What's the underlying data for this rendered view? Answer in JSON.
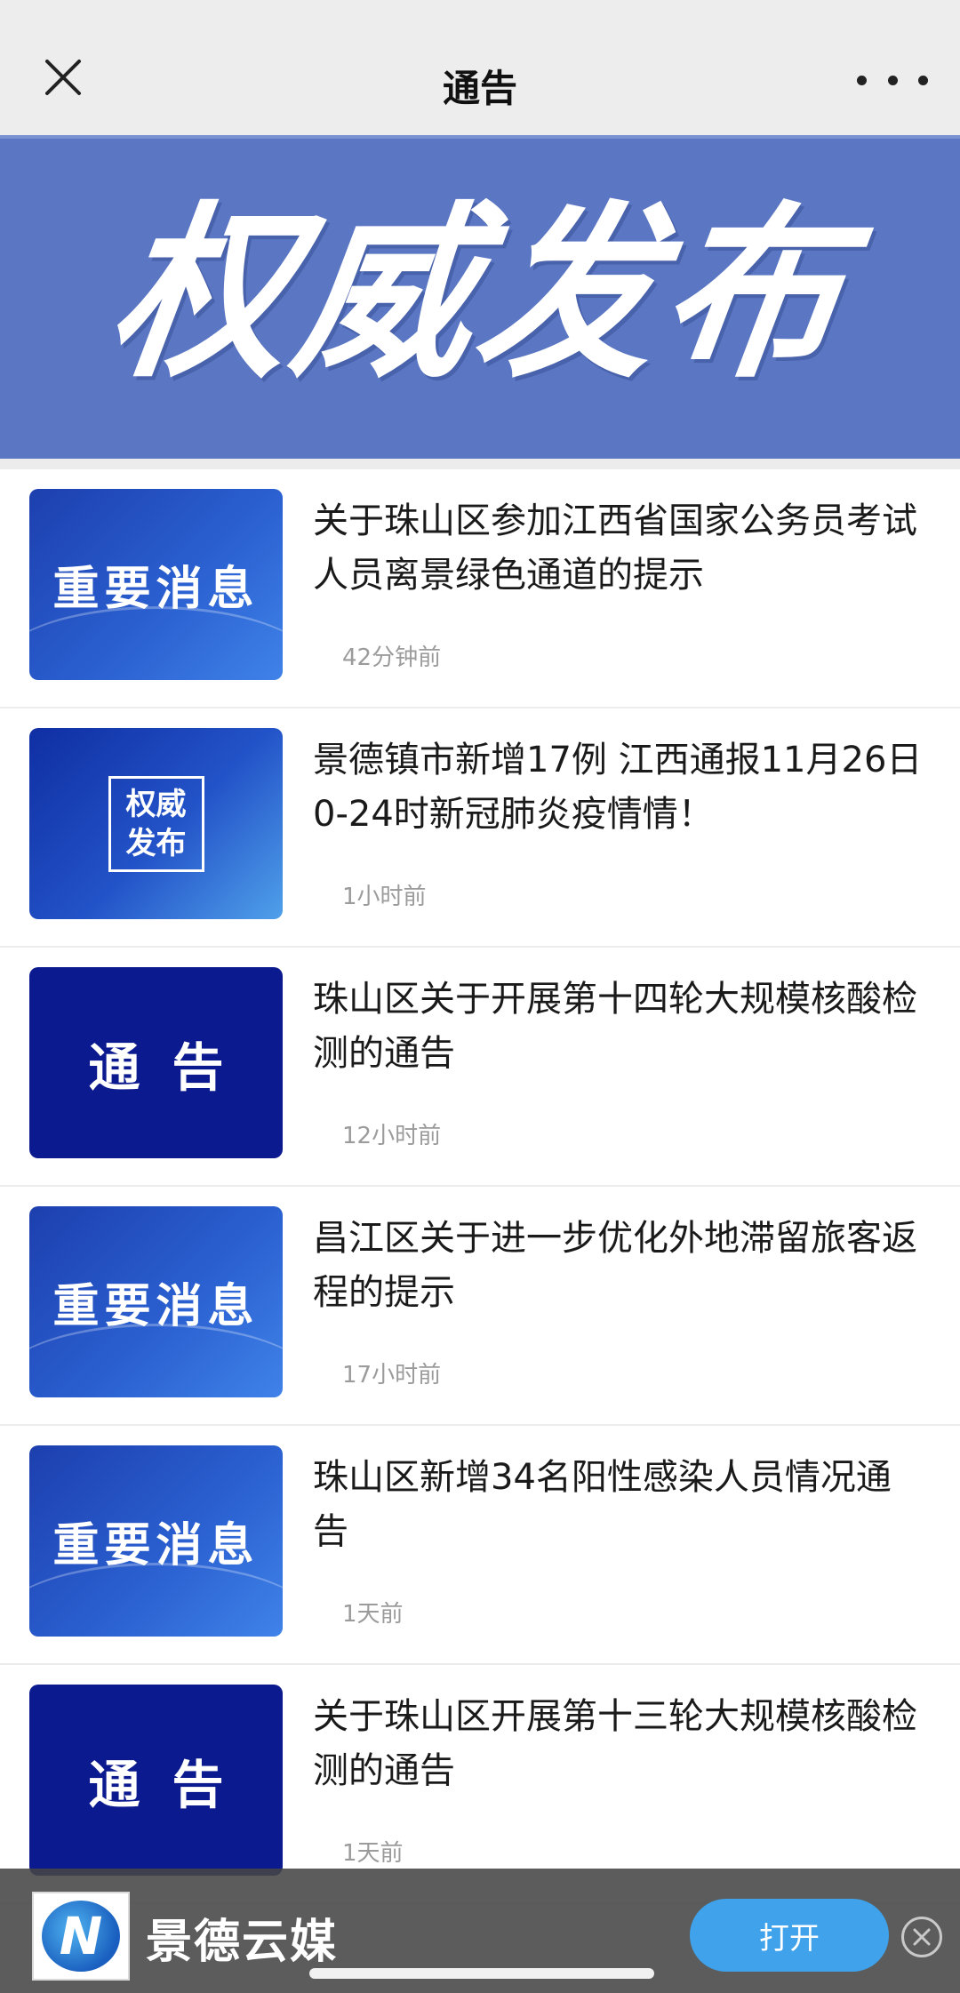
{
  "navbar": {
    "title": "通告",
    "close_icon": "close-icon",
    "more_icon": "more-dots-icon"
  },
  "banner": {
    "text": "权威发布",
    "background": "#5b77c4"
  },
  "news": [
    {
      "thumb_type": "important",
      "thumb_label": "重要消息",
      "title": "关于珠山区参加江西省国家公务员考试人员离景绿色通道的提示",
      "time": "42分钟前"
    },
    {
      "thumb_type": "authority",
      "thumb_label_line1": "权威",
      "thumb_label_line2": "发布",
      "title": "景德镇市新增17例 江西通报11月26日0-24时新冠肺炎疫情情！",
      "time": "1小时前"
    },
    {
      "thumb_type": "notice",
      "thumb_label": "通告",
      "title": "珠山区关于开展第十四轮大规模核酸检测的通告",
      "time": "12小时前"
    },
    {
      "thumb_type": "important",
      "thumb_label": "重要消息",
      "title": "昌江区关于进一步优化外地滞留旅客返程的提示",
      "time": "17小时前"
    },
    {
      "thumb_type": "important",
      "thumb_label": "重要消息",
      "title": "珠山区新增34名阳性感染人员情况通告",
      "time": "1天前"
    },
    {
      "thumb_type": "notice",
      "thumb_label": "通告",
      "title": "关于珠山区开展第十三轮大规模核酸检测的通告",
      "time": "1天前"
    }
  ],
  "app_bar": {
    "name": "景德云媒",
    "logo_letter": "N",
    "open_label": "打开",
    "accent": "#3fa2ea"
  }
}
